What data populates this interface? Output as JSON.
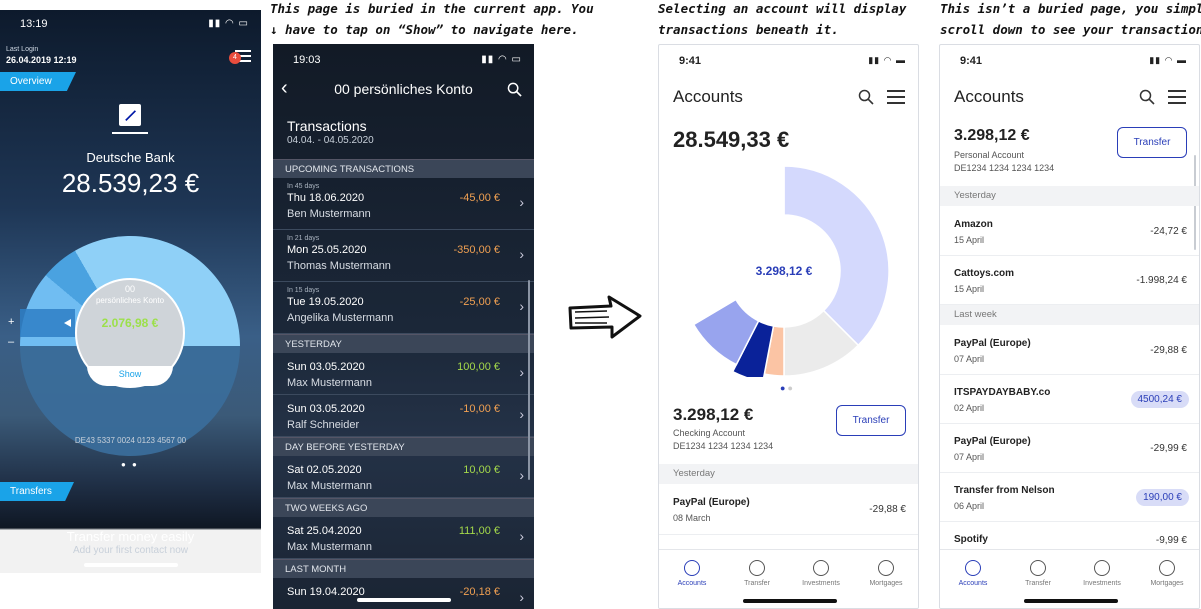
{
  "annotations": {
    "note1": [
      "This page is buried in the current app. You",
      "↓ have to tap on “Show” to navigate here."
    ],
    "note2": [
      "Selecting an account will display",
      "transactions beneath it."
    ],
    "note3": [
      "This isn’t a buried page, you simply",
      "scroll down to see your transactions."
    ]
  },
  "phone1": {
    "time": "13:19",
    "last_login_label": "Last Login",
    "last_login_date": "26.04.2019 12:19",
    "badge_count": "4",
    "overview_tab": "Overview",
    "bank_name": "Deutsche Bank",
    "total_balance": "28.539,23 €",
    "account_number": "00",
    "account_name": "persönliches Konto",
    "account_balance": "2.076,98 €",
    "show_button": "Show",
    "plus": "+",
    "minus": "–",
    "iban": "DE43 5337 0024 0123 4567 00",
    "transfers_tab": "Transfers",
    "transfer_title": "Transfer money easily",
    "transfer_subtitle": "Add your first contact now"
  },
  "phone2": {
    "time": "19:03",
    "title": "00 persönliches Konto",
    "section_title": "Transactions",
    "date_range": "04.04. - 04.05.2020",
    "groups": [
      {
        "header": "UPCOMING TRANSACTIONS",
        "rows": [
          {
            "hint": "In 45 days",
            "date": "Thu 18.06.2020",
            "name": "Ben Mustermann",
            "amount": "-45,00 €",
            "sign": "neg"
          },
          {
            "hint": "In 21 days",
            "date": "Mon 25.05.2020",
            "name": "Thomas Mustermann",
            "amount": "-350,00 €",
            "sign": "neg"
          },
          {
            "hint": "In 15 days",
            "date": "Tue 19.05.2020",
            "name": "Angelika Mustermann",
            "amount": "-25,00 €",
            "sign": "neg"
          }
        ]
      },
      {
        "header": "YESTERDAY",
        "rows": [
          {
            "hint": "",
            "date": "Sun 03.05.2020",
            "name": "Max Mustermann",
            "amount": "100,00 €",
            "sign": "pos"
          },
          {
            "hint": "",
            "date": "Sun 03.05.2020",
            "name": "Ralf Schneider",
            "amount": "-10,00 €",
            "sign": "neg"
          }
        ]
      },
      {
        "header": "DAY BEFORE YESTERDAY",
        "rows": [
          {
            "hint": "",
            "date": "Sat 02.05.2020",
            "name": "Max Mustermann",
            "amount": "10,00 €",
            "sign": "pos"
          }
        ]
      },
      {
        "header": "TWO WEEKS AGO",
        "rows": [
          {
            "hint": "",
            "date": "Sat 25.04.2020",
            "name": "Max Mustermann",
            "amount": "111,00 €",
            "sign": "pos"
          }
        ]
      },
      {
        "header": "LAST MONTH",
        "rows": [
          {
            "hint": "",
            "date": "Sun 19.04.2020",
            "name": "",
            "amount": "-20,18 €",
            "sign": "neg"
          }
        ]
      }
    ]
  },
  "phone3": {
    "time": "9:41",
    "title": "Accounts",
    "total": "28.549,33 €",
    "donut_center": "3.298,12 €",
    "donut_shares": [
      0.375,
      0.125,
      0.03,
      0.045,
      0.09,
      0.335
    ],
    "donut_colors": [
      "#d4d9fd",
      "#ebebeb",
      "#fbc4a4",
      "#0a2299",
      "#98a4ee",
      "#fff"
    ],
    "account_balance": "3.298,12 €",
    "account_type": "Checking Account",
    "account_iban": "DE1234 1234 1234 1234",
    "transfer_button": "Transfer",
    "section": "Yesterday",
    "transaction": {
      "name": "PayPal (Europe)",
      "date": "08 March",
      "amount": "-29,88 €"
    },
    "nav": [
      "Accounts",
      "Transfer",
      "Investments",
      "Mortgages"
    ],
    "accent": "#2a3eb8"
  },
  "phone4": {
    "time": "9:41",
    "title": "Accounts",
    "account_balance": "3.298,12 €",
    "account_type": "Personal Account",
    "account_iban": "DE1234 1234 1234 1234",
    "transfer_button": "Transfer",
    "sections": [
      "Yesterday",
      "Last week"
    ],
    "transactions": [
      {
        "name": "Amazon",
        "date": "15 April",
        "amount": "-24,72 €"
      },
      {
        "name": "Cattoys.com",
        "date": "15 April",
        "amount": "-1.998,24 €"
      },
      {
        "name": "PayPal (Europe)",
        "date": "07 April",
        "amount": "-29,88 €"
      },
      {
        "name": "ITSPAYDAYBABY.co",
        "date": "02 April",
        "amount": "4500,24 €"
      },
      {
        "name": "PayPal (Europe)",
        "date": "07 April",
        "amount": "-29,99 €"
      },
      {
        "name": "Transfer from Nelson",
        "date": "06 April",
        "amount": "190,00 €"
      },
      {
        "name": "Spotify",
        "date": "",
        "amount": "-9,99 €"
      }
    ],
    "nav": [
      "Accounts",
      "Transfer",
      "Investments",
      "Mortgages"
    ]
  }
}
